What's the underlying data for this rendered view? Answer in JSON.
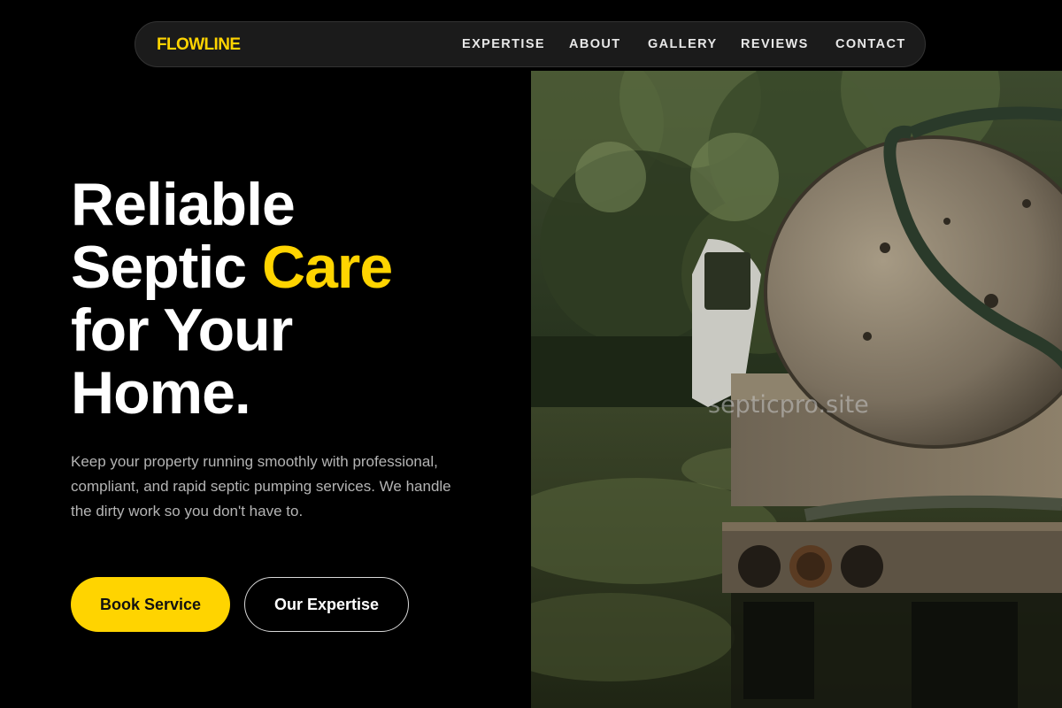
{
  "nav": {
    "brand": "FLOWLINE",
    "links": [
      "EXPERTISE",
      "ABOUT",
      "GALLERY",
      "REVIEWS",
      "CONTACT"
    ]
  },
  "hero": {
    "headline_line1": "Reliable",
    "headline_line2_pre": "Septic ",
    "headline_line2_accent": "Care",
    "headline_line3": "for Your",
    "headline_line4": "Home.",
    "subtitle": "Keep your property running smoothly with professional, compliant, and rapid septic pumping services. We handle the dirty work so you don't have to.",
    "primary_button": "Book Service",
    "secondary_button": "Our Expertise"
  },
  "image": {
    "watermark": "septicpro.site"
  },
  "colors": {
    "background": "#000000",
    "accent": "#ffd400",
    "nav_bg": "#1b1b1b",
    "text": "#ffffff",
    "muted_text": "#b4b4b4"
  }
}
